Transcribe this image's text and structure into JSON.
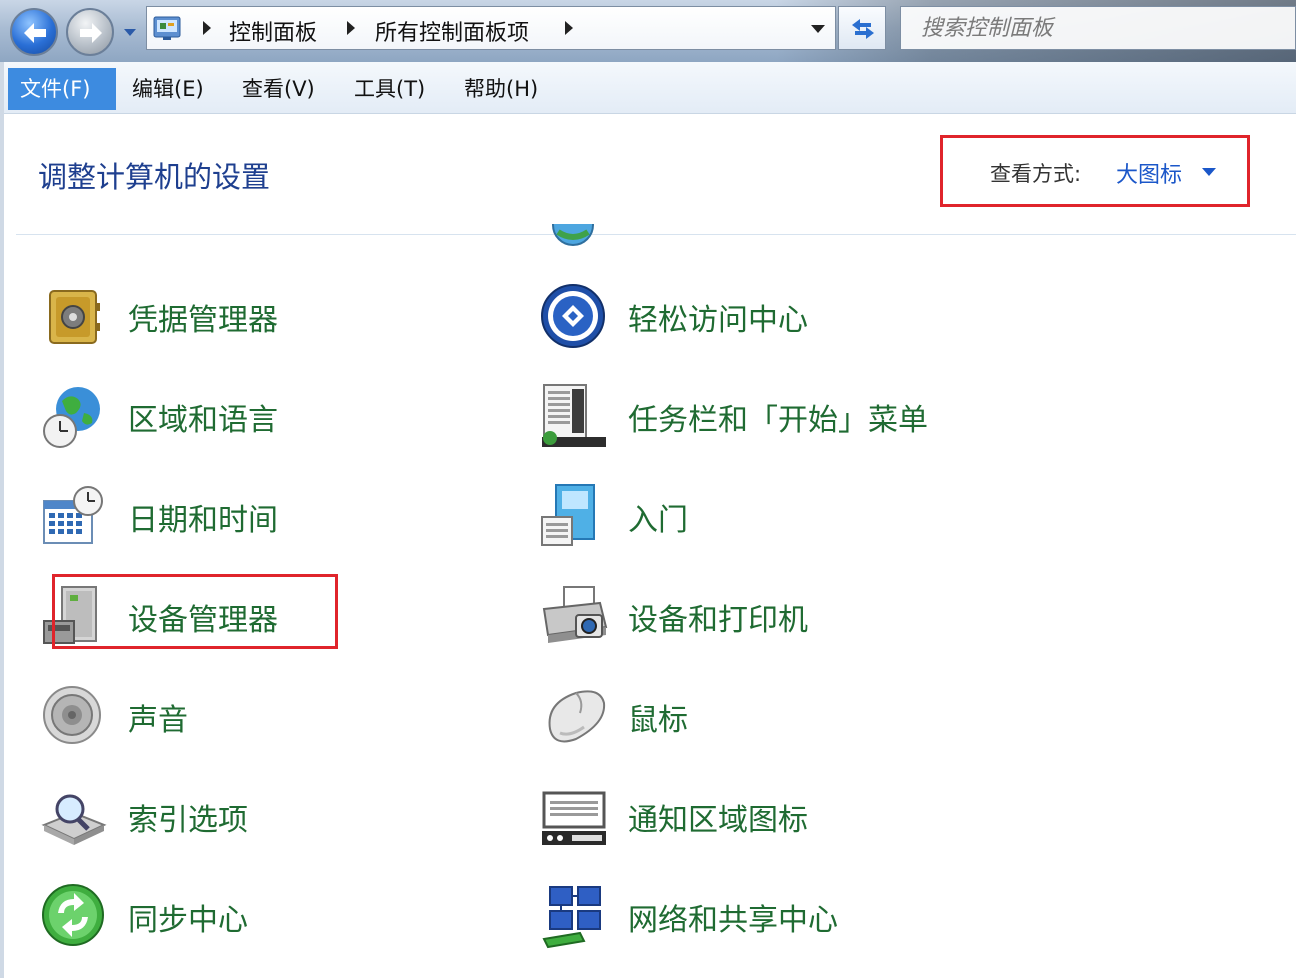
{
  "address_bar": {
    "breadcrumbs": [
      "控制面板",
      "所有控制面板项"
    ],
    "search_placeholder": "搜索控制面板"
  },
  "menu": {
    "items": [
      {
        "label": "文件(F)",
        "active": true
      },
      {
        "label": "编辑(E)",
        "active": false
      },
      {
        "label": "查看(V)",
        "active": false
      },
      {
        "label": "工具(T)",
        "active": false
      },
      {
        "label": "帮助(H)",
        "active": false
      }
    ]
  },
  "header": {
    "title": "调整计算机的设置",
    "view_by_label": "查看方式:",
    "view_by_value": "大图标"
  },
  "items_left": [
    {
      "label": "凭据管理器",
      "icon": "credential-vault-icon"
    },
    {
      "label": "区域和语言",
      "icon": "globe-clock-icon"
    },
    {
      "label": "日期和时间",
      "icon": "calendar-clock-icon"
    },
    {
      "label": "设备管理器",
      "icon": "device-manager-icon"
    },
    {
      "label": "声音",
      "icon": "speaker-icon"
    },
    {
      "label": "索引选项",
      "icon": "search-index-icon"
    },
    {
      "label": "同步中心",
      "icon": "sync-icon"
    }
  ],
  "items_right": [
    {
      "label": "轻松访问中心",
      "icon": "ease-of-access-icon"
    },
    {
      "label": "任务栏和「开始」菜单",
      "icon": "taskbar-start-icon"
    },
    {
      "label": "入门",
      "icon": "getting-started-icon"
    },
    {
      "label": "设备和打印机",
      "icon": "devices-printers-icon"
    },
    {
      "label": "鼠标",
      "icon": "mouse-icon"
    },
    {
      "label": "通知区域图标",
      "icon": "notification-area-icon"
    },
    {
      "label": "网络和共享中心",
      "icon": "network-sharing-icon"
    }
  ],
  "colors": {
    "item_text": "#1f6b32",
    "title_text": "#1e3f8f",
    "highlight_red": "#e0242b",
    "menu_active": "#3d8be0"
  }
}
